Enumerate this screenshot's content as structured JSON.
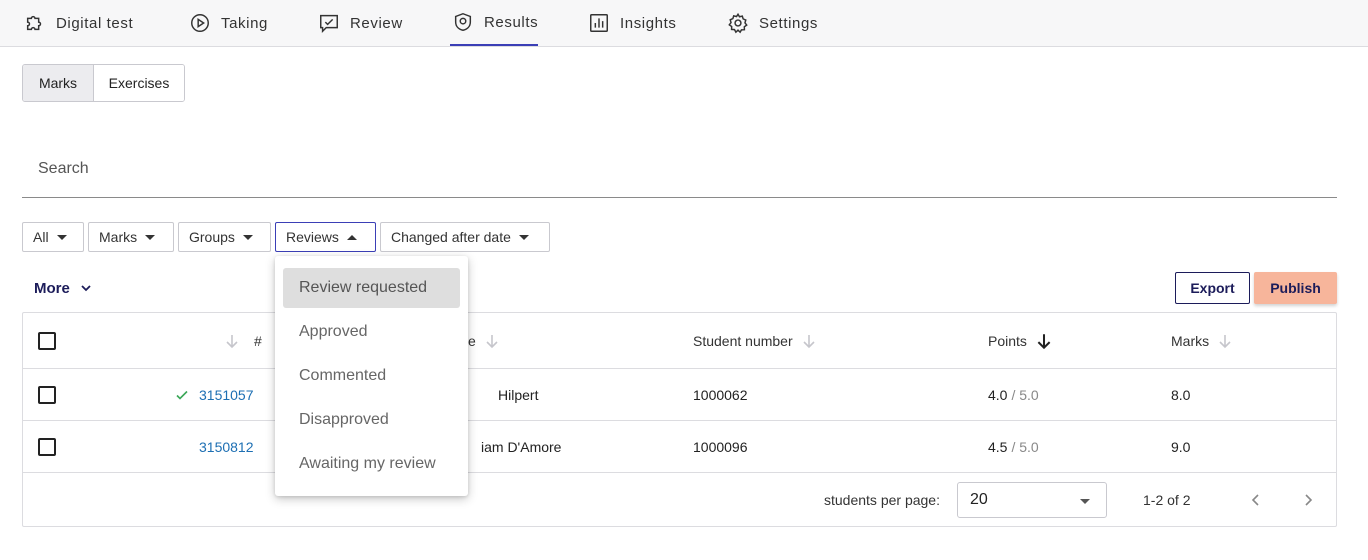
{
  "nav": {
    "items": [
      {
        "label": "Digital test",
        "icon": "puzzle-icon"
      },
      {
        "label": "Taking",
        "icon": "play-circle-icon"
      },
      {
        "label": "Review",
        "icon": "review-chat-icon"
      },
      {
        "label": "Results",
        "icon": "shield-badge-icon",
        "active": true
      },
      {
        "label": "Insights",
        "icon": "bar-chart-icon"
      },
      {
        "label": "Settings",
        "icon": "gear-icon"
      }
    ]
  },
  "view_toggle": {
    "marks": "Marks",
    "exercises": "Exercises",
    "selected": "Marks"
  },
  "search": {
    "placeholder": "Search"
  },
  "filters": {
    "all": "All",
    "marks": "Marks",
    "groups": "Groups",
    "reviews": "Reviews",
    "changed_after_date": "Changed after date"
  },
  "reviews_dropdown": {
    "options": [
      "Review requested",
      "Approved",
      "Commented",
      "Disapproved",
      "Awaiting my review"
    ],
    "highlighted": "Review requested"
  },
  "toolbar": {
    "more": "More",
    "export": "Export",
    "publish": "Publish"
  },
  "table": {
    "headers": {
      "number": "#",
      "name": "e",
      "student_number": "Student number",
      "points": "Points",
      "marks": "Marks"
    },
    "rows": [
      {
        "number": "3151057",
        "name": "Hilpert",
        "student_number": "1000062",
        "points": "4.0",
        "points_max": "/ 5.0",
        "mark": "8.0",
        "reviewed": true
      },
      {
        "number": "3150812",
        "name": "iam D'Amore",
        "student_number": "1000096",
        "points": "4.5",
        "points_max": "/ 5.0",
        "mark": "9.0",
        "reviewed": false
      }
    ],
    "footer": {
      "per_page_label": "students per page:",
      "per_page_value": "20",
      "range": "1-2 of 2"
    }
  },
  "colors": {
    "accent": "#3b3fb6",
    "primary_text": "#1c1c5a",
    "publish_bg": "#f7b59b",
    "link": "#1d6fb3",
    "check": "#3aa757"
  }
}
